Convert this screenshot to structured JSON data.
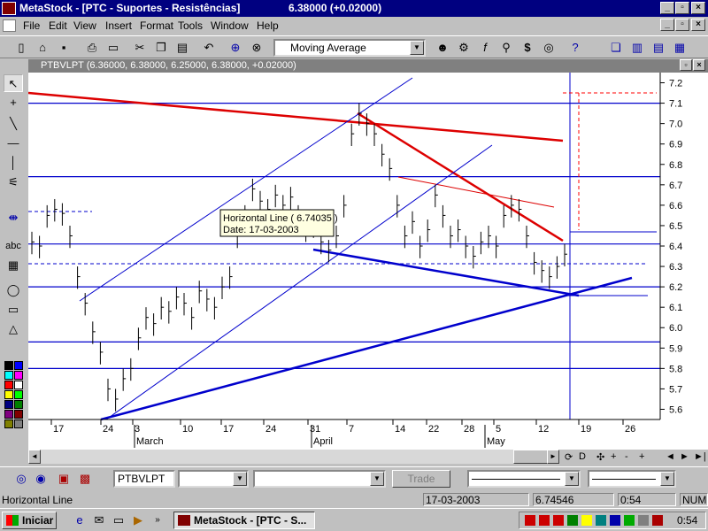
{
  "window": {
    "title": "MetaStock - [PTC - Suportes - Resistências]",
    "price_readout": "6.38000 (+0.02000)"
  },
  "menu": [
    "File",
    "Edit",
    "View",
    "Insert",
    "Format",
    "Tools",
    "Window",
    "Help"
  ],
  "toolbar": {
    "indicator_combo": "Moving Average"
  },
  "child_window": {
    "title": "PTBVLPT (6.36000, 6.38000, 6.25000, 6.38000, +0.02000)"
  },
  "tooltip": {
    "line1": "Horizontal Line ( 6.74035 )",
    "line2": "Date: 17-03-2003"
  },
  "chart_data": {
    "type": "ohlc-bar",
    "y_ticks": [
      "7.2",
      "7.1",
      "7.0",
      "6.9",
      "6.8",
      "6.7",
      "6.6",
      "6.5",
      "6.4",
      "6.3",
      "6.2",
      "6.1",
      "6.0",
      "5.9",
      "5.8",
      "5.7",
      "5.6"
    ],
    "ylim": [
      5.55,
      7.25
    ],
    "day_ticks": [
      "17",
      "24",
      "3",
      "10",
      "17",
      "24",
      "31",
      "7",
      "14",
      "22",
      "28",
      "5",
      "12",
      "19",
      "26"
    ],
    "month_labels": [
      "March",
      "April",
      "May"
    ],
    "horizontal_lines": [
      7.1,
      6.74,
      6.41,
      6.2,
      5.93,
      5.8
    ]
  },
  "bottom_toolbar": {
    "security_combo": "PTBVLPT",
    "trade_button": "Trade",
    "axis_buttons": [
      "D",
      "+",
      "-",
      "+"
    ]
  },
  "status": {
    "message": "Horizontal Line",
    "date": "17-03-2003",
    "value": "6.74546",
    "time": "0:54",
    "mode": "NUM"
  },
  "taskbar": {
    "start": "Iniciar",
    "task": "MetaStock - [PTC - S...",
    "clock": "0:54"
  },
  "colors": {
    "title_bg": "#000080",
    "trend_red": "#dd0000",
    "trend_blue": "#0000cc"
  }
}
